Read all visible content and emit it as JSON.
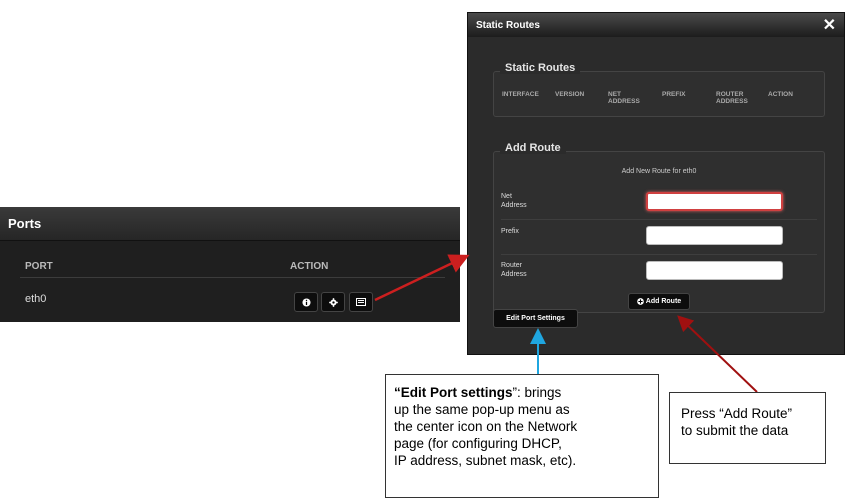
{
  "ports_panel": {
    "title": "Ports",
    "columns": {
      "port": "PORT",
      "action": "ACTION"
    },
    "rows": [
      {
        "port": "eth0"
      }
    ],
    "action_icons": [
      "info-icon",
      "gear-icon",
      "network-card-icon"
    ]
  },
  "modal": {
    "title": "Static Routes",
    "close_label": "✕",
    "static_routes": {
      "legend": "Static Routes",
      "columns": {
        "interface": "INTERFACE",
        "version": "VERSION",
        "net_address_1": "NET",
        "net_address_2": "ADDRESS",
        "prefix": "PREFIX",
        "router_address_1": "ROUTER",
        "router_address_2": "ADDRESS",
        "action": "ACTION"
      }
    },
    "add_route": {
      "legend": "Add Route",
      "subtitle": "Add New Route for eth0",
      "net_address_label_1": "Net",
      "net_address_label_2": "Address",
      "prefix_label": "Prefix",
      "router_address_label_1": "Router",
      "router_address_label_2": "Address",
      "net_address_value": "",
      "prefix_value": "",
      "router_address_value": "",
      "add_button": "Add Route",
      "add_icon": "plus-circle-icon"
    },
    "edit_port_button": "Edit Port Settings"
  },
  "callouts": {
    "edit_port": {
      "bold": "“Edit Port settings",
      "line1_rest": "”:  brings",
      "line2": "up the same pop-up menu as",
      "line3": "the center icon on the Network",
      "line4": "page (for configuring DHCP,",
      "line5": "IP address, subnet mask, etc)."
    },
    "add_route": {
      "line1": "Press “Add Route”",
      "line2": "to submit the data"
    }
  },
  "colors": {
    "red_arrow": "#cc1f1f",
    "dark_red_arrow": "#a01010",
    "blue_arrow": "#1fa6e0"
  }
}
